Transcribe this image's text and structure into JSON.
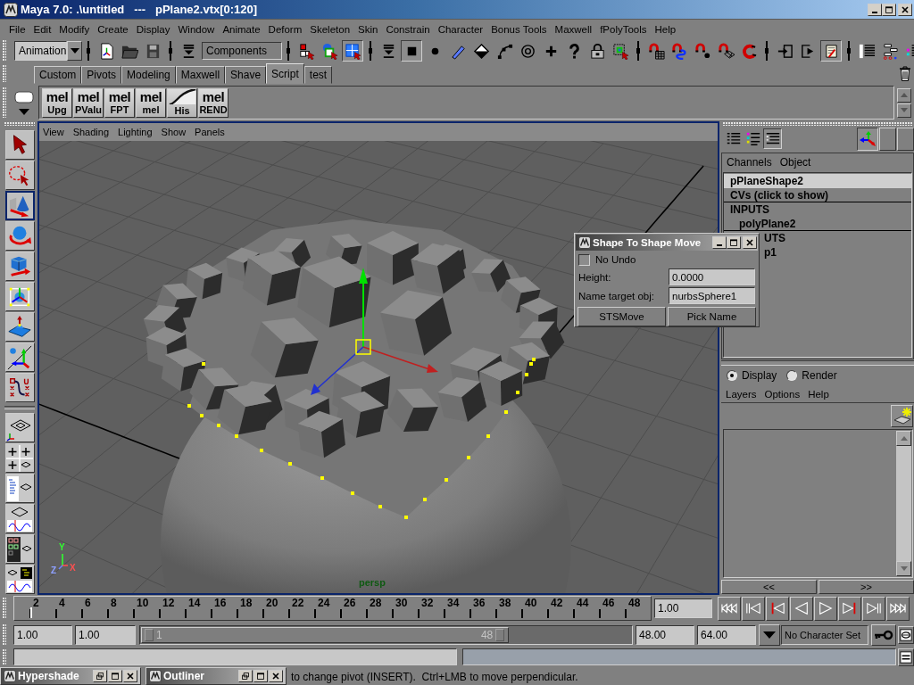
{
  "window": {
    "title": "Maya 7.0: .\\untitled   ---   pPlane2.vtx[0:120]"
  },
  "menu_bar": [
    "File",
    "Edit",
    "Modify",
    "Create",
    "Display",
    "Window",
    "Animate",
    "Deform",
    "Skeleton",
    "Skin",
    "Constrain",
    "Character",
    "Bonus Tools",
    "Maxwell",
    "fPolyTools",
    "Help"
  ],
  "status_line": {
    "menu_set": "Animation",
    "selection_mode": "Components",
    "buttons": [
      {
        "on": false
      },
      {
        "on": false
      },
      {
        "on": false
      },
      {
        "on": false
      },
      {
        "on": false
      },
      {
        "on": false
      },
      {
        "on": true
      },
      {
        "on": false
      },
      {
        "on": true
      },
      {
        "on": false
      },
      {
        "on": false
      },
      {
        "on": false
      },
      {
        "on": false
      },
      {
        "on": false
      },
      {
        "on": false
      },
      {
        "on": false
      },
      {
        "on": false
      },
      {
        "on": false
      },
      {
        "on": false
      },
      {
        "on": false
      },
      {
        "on": false
      },
      {
        "on": false
      },
      {
        "on": false
      },
      {
        "on": false
      },
      {
        "on": false
      },
      {
        "on": true
      },
      {
        "on": false
      },
      {
        "on": false
      },
      {
        "on": false
      }
    ]
  },
  "shelf": {
    "tabs": [
      {
        "label": "Custom",
        "selected": false
      },
      {
        "label": "Pivots",
        "selected": false
      },
      {
        "label": "Modeling",
        "selected": false
      },
      {
        "label": "Maxwell",
        "selected": false
      },
      {
        "label": "Shave",
        "selected": false
      },
      {
        "label": "Script",
        "selected": true
      },
      {
        "label": "test",
        "selected": false
      }
    ],
    "buttons": [
      {
        "kind": "mel",
        "badge": "mel",
        "label": "Upg"
      },
      {
        "kind": "mel",
        "badge": "mel",
        "label": "PValu"
      },
      {
        "kind": "mel",
        "badge": "mel",
        "label": "FPT"
      },
      {
        "kind": "mel",
        "badge": "mel",
        "label": "mel"
      },
      {
        "kind": "curve",
        "label": "His"
      },
      {
        "kind": "mel",
        "badge": "mel",
        "label": "REND"
      }
    ]
  },
  "toolbox": {
    "tools": [
      {
        "selected": false
      },
      {
        "selected": false
      },
      {
        "selected": true
      },
      {
        "selected": false
      },
      {
        "selected": false
      },
      {
        "selected": false
      },
      {
        "selected": false
      },
      {
        "selected": false
      },
      {
        "selected": false
      }
    ]
  },
  "viewport": {
    "menu": [
      "View",
      "Shading",
      "Lighting",
      "Show",
      "Panels"
    ],
    "axis_labels": [
      "Y",
      "X",
      "Z"
    ],
    "camera": "persp"
  },
  "dialog": {
    "title": "Shape To Shape Move",
    "no_undo": {
      "label": "No Undo",
      "checked": false
    },
    "fields": [
      {
        "label": "Height:",
        "value": "0.0000"
      },
      {
        "label": "Name target obj:",
        "value": "nurbsSphere1"
      }
    ],
    "buttons": [
      "STSMove",
      "Pick Name"
    ]
  },
  "channel_box": {
    "view_buttons": [
      {
        "selected": false
      },
      {
        "selected": false
      },
      {
        "selected": true
      }
    ],
    "manipulator_toggle": {
      "on": true
    },
    "menu": [
      "Channels",
      "Object"
    ],
    "object": {
      "name": "pPlaneShape2",
      "selected": true
    },
    "attributes": [
      "CVs (click to show)"
    ],
    "sections": [
      {
        "title": "INPUTS",
        "nodes": [
          "polyPlane2"
        ]
      },
      {
        "title": "UTS",
        "nodes": [
          "p1"
        ]
      }
    ]
  },
  "layer_editor": {
    "modes": [
      {
        "label": "Display",
        "selected": true
      },
      {
        "label": "Render",
        "selected": false
      }
    ],
    "menu": [
      "Layers",
      "Options",
      "Help"
    ],
    "page_buttons": [
      "<<",
      ">>"
    ]
  },
  "time_slider": {
    "ticks": [
      "2",
      "4",
      "6",
      "8",
      "10",
      "12",
      "14",
      "16",
      "18",
      "20",
      "22",
      "24",
      "26",
      "28",
      "30",
      "32",
      "34",
      "36",
      "38",
      "40",
      "42",
      "44",
      "46",
      "48"
    ],
    "level": 0.025,
    "current_time": "1.00"
  },
  "range_slider": {
    "start_time": "1.00",
    "playback_start": "1.00",
    "handle_start": "1",
    "handle_end": "48",
    "level": 0.75,
    "playback_end": "48.00",
    "end_time": "64.00",
    "character_set": "No Character Set"
  },
  "minimized_windows": [
    {
      "title": "Hypershade"
    },
    {
      "title": "Outliner"
    }
  ],
  "help_line": {
    "text": "to change pivot (INSERT).  Ctrl+LMB to move perpendicular."
  }
}
